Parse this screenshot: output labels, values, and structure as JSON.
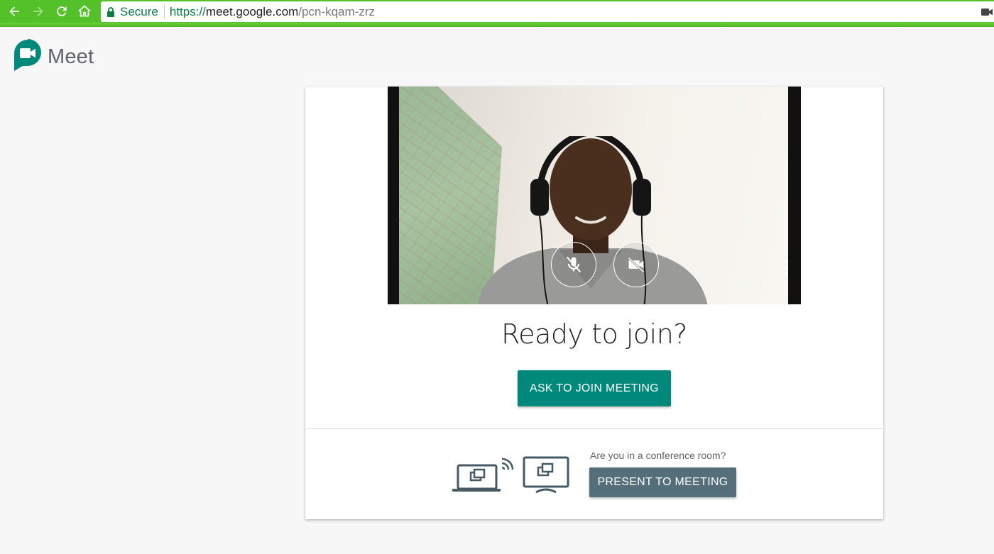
{
  "browser": {
    "secure_label": "Secure",
    "url_scheme": "https://",
    "url_host": "meet.google.com",
    "url_path": "/pcn-kqam-zrz",
    "icons": [
      "back-arrow-icon",
      "forward-arrow-icon",
      "reload-icon",
      "home-icon",
      "lock-icon",
      "camera-indicator-icon"
    ]
  },
  "header": {
    "app_name": "Meet",
    "logo_icon": "meet-logo-icon"
  },
  "preview": {
    "mic_icon": "mic-off-icon",
    "camera_icon": "camera-off-icon",
    "more_icon": "more-vert-icon"
  },
  "join": {
    "title": "Ready to join?",
    "ask_button_label": "ASK TO JOIN MEETING"
  },
  "present": {
    "question": "Are you in a conference room?",
    "button_label": "PRESENT TO MEETING",
    "graphic_icon": "laptop-cast-to-display-icon"
  },
  "colors": {
    "chrome_green": "#55c12a",
    "primary_teal": "#00897b",
    "present_slate": "#546e7a",
    "secure_green": "#0b8043"
  }
}
